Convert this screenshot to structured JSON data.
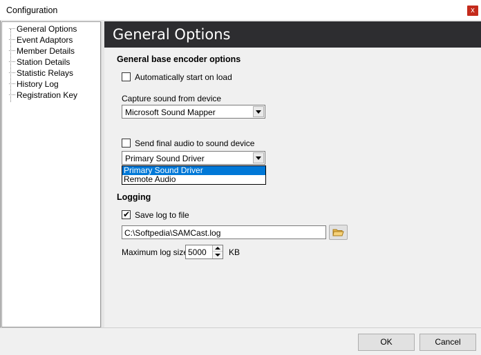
{
  "window": {
    "title": "Configuration",
    "close_glyph": "x"
  },
  "tree": {
    "items": [
      {
        "label": "General Options"
      },
      {
        "label": "Event Adaptors"
      },
      {
        "label": "Member Details"
      },
      {
        "label": "Station Details"
      },
      {
        "label": "Statistic Relays"
      },
      {
        "label": "History Log"
      },
      {
        "label": "Registration Key"
      }
    ]
  },
  "panel": {
    "title": "General Options",
    "encoder": {
      "section_title": "General base encoder options",
      "auto_start": {
        "label": "Automatically start on load",
        "checked": false
      },
      "capture_label": "Capture sound from device",
      "capture_device": "Microsoft Sound Mapper",
      "send_final": {
        "label": "Send final audio to sound device",
        "checked": false
      },
      "output_device": "Primary Sound Driver",
      "output_options": [
        "Primary Sound Driver",
        "Remote Audio"
      ]
    },
    "logging": {
      "section_title": "Logging",
      "save_log": {
        "label": "Save log to file",
        "checked": true,
        "glyph": "✔"
      },
      "log_path": "C:\\Softpedia\\SAMCast.log",
      "max_size_label": "Maximum log size",
      "max_size_value": "5000",
      "max_size_unit": "KB"
    }
  },
  "footer": {
    "ok_label": "OK",
    "cancel_label": "Cancel"
  },
  "colors": {
    "header_bg": "#2d2d30",
    "selection": "#0078d7",
    "close_bg": "#c42b1c",
    "folder_icon": "#e8b84a"
  }
}
